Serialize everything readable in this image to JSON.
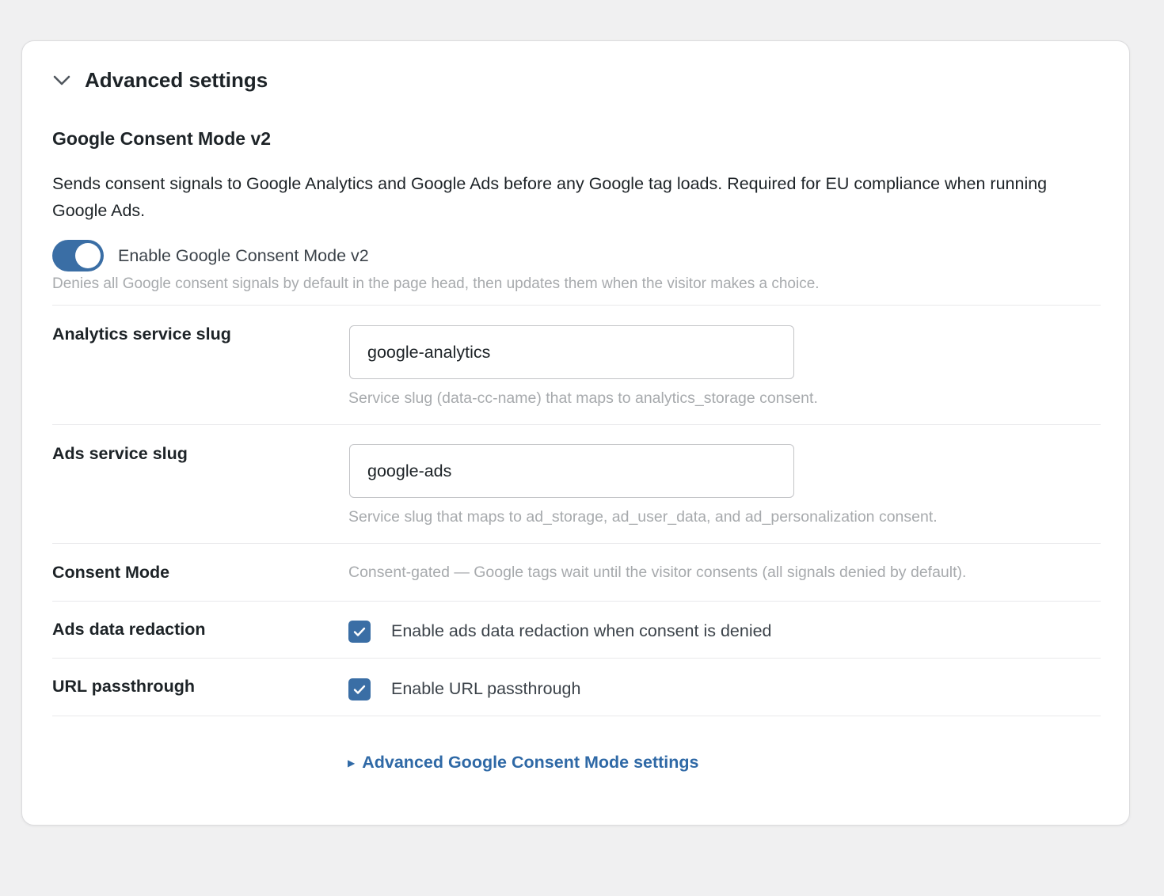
{
  "section": {
    "title": "Advanced settings",
    "chevron_icon": "chevron-down-icon"
  },
  "gcm": {
    "title": "Google Consent Mode v2",
    "description": "Sends consent signals to Google Analytics and Google Ads before any Google tag loads. Required for EU compliance when running Google Ads.",
    "toggle": {
      "label": "Enable Google Consent Mode v2",
      "enabled": true,
      "help": "Denies all Google consent signals by default in the page head, then updates them when the visitor makes a choice."
    }
  },
  "fields": {
    "analytics": {
      "label": "Analytics service slug",
      "value": "google-analytics",
      "help": "Service slug (data-cc-name) that maps to analytics_storage consent."
    },
    "ads": {
      "label": "Ads service slug",
      "value": "google-ads",
      "help": "Service slug that maps to ad_storage, ad_user_data, and ad_personalization consent."
    },
    "consent_mode": {
      "label": "Consent Mode",
      "value": "Consent-gated — Google tags wait until the visitor consents (all signals denied by default)."
    },
    "ads_redaction": {
      "label": "Ads data redaction",
      "checkbox_label": "Enable ads data redaction when consent is denied",
      "checked": true
    },
    "url_passthrough": {
      "label": "URL passthrough",
      "checkbox_label": "Enable URL passthrough",
      "checked": true
    }
  },
  "advanced_link": {
    "label": "Advanced Google Consent Mode settings",
    "icon": "triangle-right-icon"
  },
  "colors": {
    "accent": "#3a6ea5",
    "link": "#2f69a6",
    "muted_text": "#a7aaad",
    "background": "#f0f0f1"
  }
}
